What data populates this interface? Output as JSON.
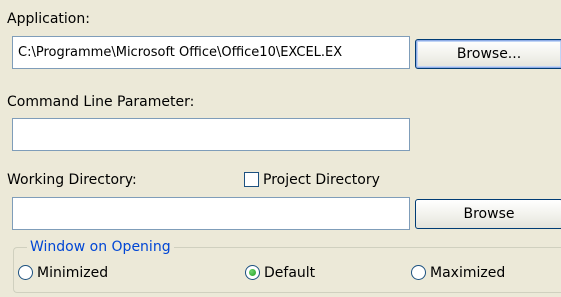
{
  "application": {
    "label": "Application:",
    "value": "C:\\Programme\\Microsoft Office\\Office10\\EXCEL.EX",
    "browse_label": "Browse..."
  },
  "command_line": {
    "label": "Command Line Parameter:",
    "value": ""
  },
  "working_directory": {
    "label": "Working Directory:",
    "value": "",
    "project_directory_label": "Project Directory",
    "project_directory_checked": false,
    "browse_label": "Browse"
  },
  "window_on_opening": {
    "legend": "Window on Opening",
    "options": [
      {
        "label": "Minimized",
        "selected": false
      },
      {
        "label": "Default",
        "selected": true
      },
      {
        "label": "Maximized",
        "selected": false
      }
    ]
  },
  "colors": {
    "dialog_background": "#ece9d8",
    "group_legend": "#0046d5",
    "field_border": "#7f9db9",
    "radio_selected": "#21a121"
  }
}
